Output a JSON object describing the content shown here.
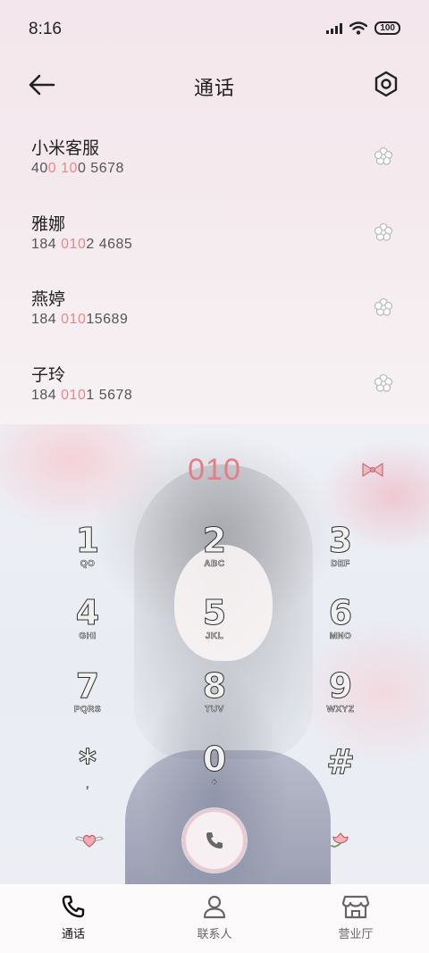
{
  "status_bar": {
    "time": "8:16",
    "battery": "100"
  },
  "header": {
    "title": "通话"
  },
  "contacts": [
    {
      "name": "小米客服",
      "number_parts": [
        "40",
        "0",
        " ",
        "10",
        "0 5678"
      ]
    },
    {
      "name": "雅娜",
      "number_parts": [
        "184 ",
        "010",
        "2 4685",
        "",
        ""
      ]
    },
    {
      "name": "燕婷",
      "number_parts": [
        "184 ",
        "010",
        "15689",
        "",
        ""
      ]
    },
    {
      "name": "子玲",
      "number_parts": [
        "184 ",
        "010",
        "1 5678",
        "",
        ""
      ]
    }
  ],
  "dial": {
    "input": "010",
    "accent_color": "#e57e84"
  },
  "keypad": [
    {
      "digit": "1",
      "letters": "QO"
    },
    {
      "digit": "2",
      "letters": "ABC"
    },
    {
      "digit": "3",
      "letters": "DEF"
    },
    {
      "digit": "4",
      "letters": "GHI"
    },
    {
      "digit": "5",
      "letters": "JKL"
    },
    {
      "digit": "6",
      "letters": "MNO"
    },
    {
      "digit": "7",
      "letters": "PQRS"
    },
    {
      "digit": "8",
      "letters": "TUV"
    },
    {
      "digit": "9",
      "letters": "WXYZ"
    },
    {
      "digit": "*",
      "letters": ","
    },
    {
      "digit": "0",
      "letters": "+"
    },
    {
      "digit": "#",
      "letters": ""
    }
  ],
  "bottom_nav": [
    {
      "label": "通话",
      "icon": "phone-icon",
      "active": true
    },
    {
      "label": "联系人",
      "icon": "person-icon",
      "active": false
    },
    {
      "label": "营业厅",
      "icon": "store-icon",
      "active": false
    }
  ]
}
